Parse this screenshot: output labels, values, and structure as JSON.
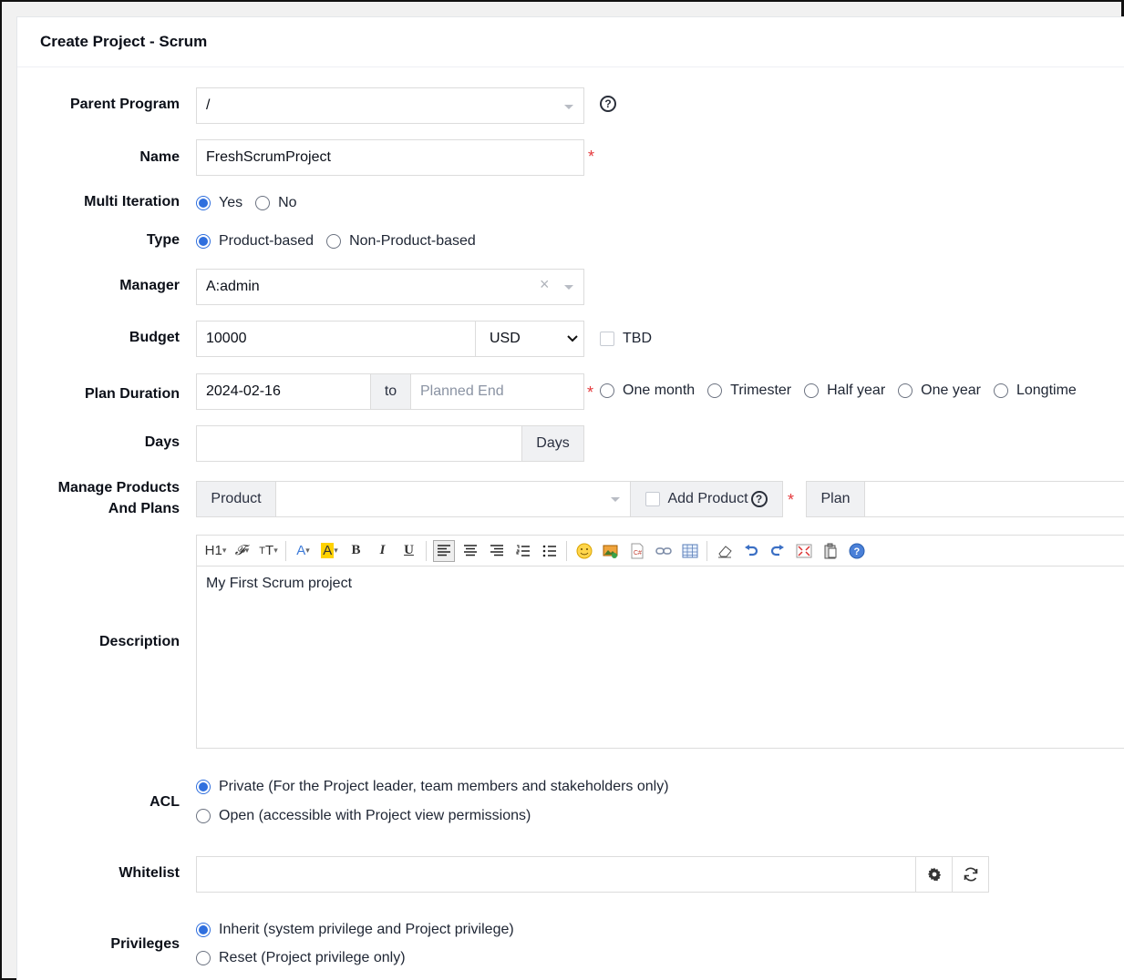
{
  "card": {
    "title": "Create Project - Scrum"
  },
  "parent_program": {
    "label": "Parent Program",
    "value": "/"
  },
  "name": {
    "label": "Name",
    "value": "FreshScrumProject",
    "required": "*"
  },
  "multi_iteration": {
    "label": "Multi Iteration",
    "options": [
      "Yes",
      "No"
    ],
    "selected": "Yes"
  },
  "type": {
    "label": "Type",
    "options": [
      "Product-based",
      "Non-Product-based"
    ],
    "selected": "Product-based"
  },
  "manager": {
    "label": "Manager",
    "value": "A:admin",
    "clear": "×"
  },
  "budget": {
    "label": "Budget",
    "value": "10000",
    "currency": "USD",
    "tbd_label": "TBD"
  },
  "plan_duration": {
    "label": "Plan Duration",
    "begin": "2024-02-16",
    "to": "to",
    "end_placeholder": "Planned End",
    "required": "*",
    "presets": [
      "One month",
      "Trimester",
      "Half year",
      "One year",
      "Longtime"
    ]
  },
  "days": {
    "label": "Days",
    "addon": "Days"
  },
  "products": {
    "label_line1": "Manage Products",
    "label_line2": "And Plans",
    "product_addon": "Product",
    "add_product_label": "Add Product",
    "required": "*",
    "plan_addon": "Plan"
  },
  "description": {
    "label": "Description",
    "content": "My First Scrum project",
    "toolbar": [
      "H1",
      "F",
      "tT",
      "A",
      "A",
      "B",
      "I",
      "U",
      "align-left",
      "align-center",
      "align-right",
      "ordered-list",
      "unordered-list",
      "emoji",
      "image",
      "code",
      "link",
      "table",
      "eraser",
      "undo",
      "redo",
      "fullscreen",
      "paste",
      "help"
    ]
  },
  "acl": {
    "label": "ACL",
    "options": [
      "Private (For the Project leader, team members and stakeholders only)",
      "Open (accessible with Project view permissions)"
    ],
    "selected": "Private (For the Project leader, team members and stakeholders only)"
  },
  "whitelist": {
    "label": "Whitelist"
  },
  "privileges": {
    "label": "Privileges",
    "options": [
      "Inherit (system privilege and Project privilege)",
      "Reset (Project privilege only)"
    ],
    "selected": "Inherit (system privilege and Project privilege)"
  },
  "colors": {
    "accent": "#2f6fde",
    "required": "#e4393c"
  }
}
